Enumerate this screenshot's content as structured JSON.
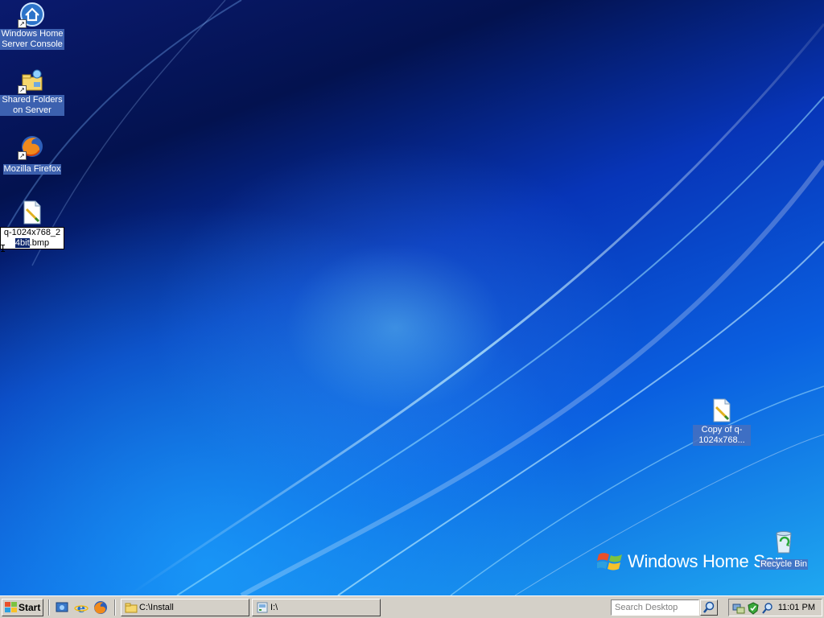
{
  "desktop": {
    "icons": [
      {
        "label": "Windows Home Server Console",
        "icon": "home-server-icon",
        "shortcut": true
      },
      {
        "label": "Shared Folders on Server",
        "icon": "shared-folder-icon",
        "shortcut": true
      },
      {
        "label": "Mozilla Firefox",
        "icon": "firefox-icon",
        "shortcut": true
      },
      {
        "label": "Copy of q-1024x768...",
        "icon": "bitmap-file-icon",
        "shortcut": false
      },
      {
        "label": "Recycle Bin",
        "icon": "recycle-bin-icon",
        "shortcut": false
      }
    ],
    "rename": {
      "before": "q-1024x768_2",
      "selected": "4bit",
      "after": ".bmp",
      "icon": "bitmap-file-icon"
    },
    "logo_text": "Windows Home Server",
    "wallpaper_colors": {
      "dark": "#03124f",
      "mid": "#0735b8",
      "light": "#1fa8f0"
    }
  },
  "taskbar": {
    "start_label": "Start",
    "quick_launch": [
      "show-desktop-icon",
      "internet-explorer-icon",
      "firefox-icon"
    ],
    "tasks": [
      {
        "label": "C:\\Install",
        "icon": "folder-icon"
      },
      {
        "label": "I:\\",
        "icon": "drive-icon"
      }
    ],
    "search_placeholder": "Search Desktop",
    "tray_icons": [
      "network-icon",
      "security-icon",
      "search-tray-icon"
    ],
    "clock": "11:01 PM"
  }
}
